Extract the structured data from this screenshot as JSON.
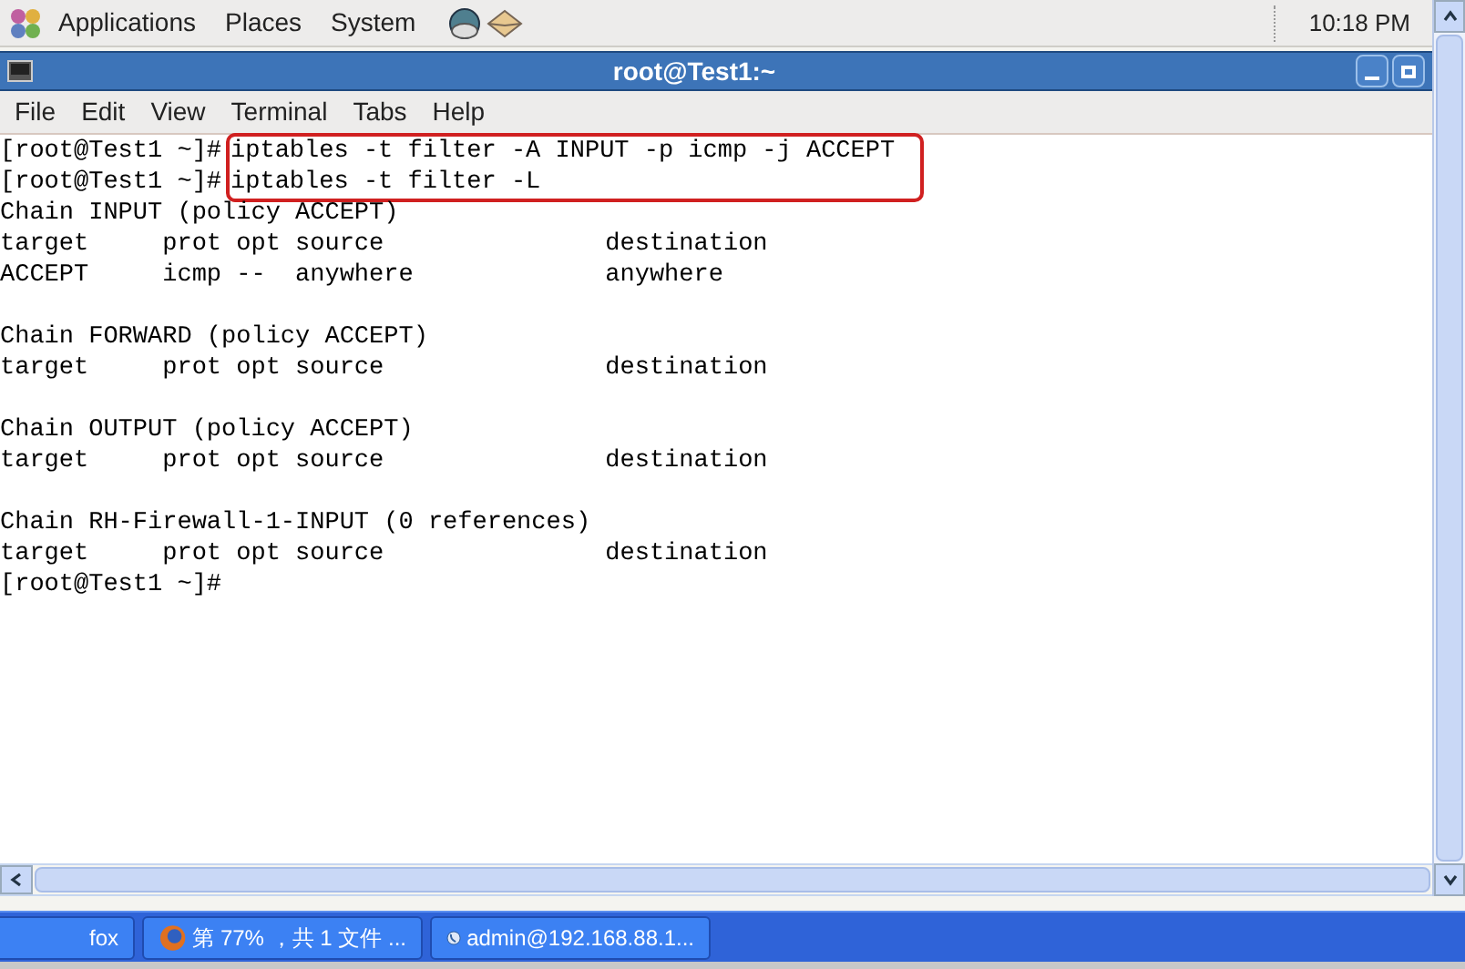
{
  "top_panel": {
    "menus": [
      "Applications",
      "Places",
      "System"
    ],
    "clock": "10:18 PM"
  },
  "window": {
    "title": "root@Test1:~"
  },
  "menu_bar": [
    "File",
    "Edit",
    "View",
    "Terminal",
    "Tabs",
    "Help"
  ],
  "terminal": {
    "lines": [
      {
        "kind": "command",
        "prompt": "[root@Test1 ~]#",
        "command": "iptables -t filter -A INPUT -p icmp -j ACCEPT",
        "circled": true
      },
      {
        "kind": "command",
        "prompt": "[root@Test1 ~]#",
        "command": "iptables -t filter -L",
        "circled": true
      },
      {
        "kind": "output",
        "text": "Chain INPUT (policy ACCEPT)"
      },
      {
        "kind": "output",
        "text": "target     prot opt source               destination"
      },
      {
        "kind": "output",
        "text": "ACCEPT     icmp --  anywhere             anywhere"
      },
      {
        "kind": "blank"
      },
      {
        "kind": "output",
        "text": "Chain FORWARD (policy ACCEPT)"
      },
      {
        "kind": "output",
        "text": "target     prot opt source               destination"
      },
      {
        "kind": "blank"
      },
      {
        "kind": "output",
        "text": "Chain OUTPUT (policy ACCEPT)"
      },
      {
        "kind": "output",
        "text": "target     prot opt source               destination"
      },
      {
        "kind": "blank"
      },
      {
        "kind": "output",
        "text": "Chain RH-Firewall-1-INPUT (0 references)"
      },
      {
        "kind": "output",
        "text": "target     prot opt source               destination"
      },
      {
        "kind": "command",
        "prompt": "[root@Test1 ~]#",
        "circled": false
      }
    ]
  },
  "taskbar": {
    "items": [
      {
        "kind": "plain",
        "label": "fox"
      },
      {
        "kind": "browser",
        "label": "第 77% ，共 1 文件 ..."
      },
      {
        "kind": "ssh",
        "label": "admin@192.168.88.1..."
      }
    ]
  }
}
